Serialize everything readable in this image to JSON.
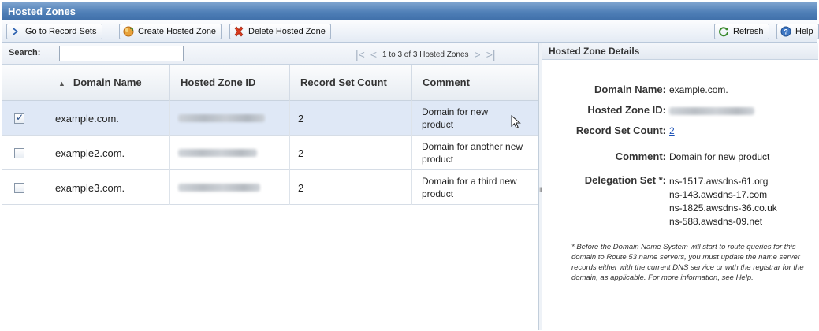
{
  "window": {
    "title": "Hosted Zones"
  },
  "toolbar": {
    "go_to_record_sets": "Go to Record Sets",
    "create_hosted_zone": "Create Hosted Zone",
    "delete_hosted_zone": "Delete Hosted Zone",
    "refresh": "Refresh",
    "help": "Help"
  },
  "search": {
    "label": "Search:",
    "value": ""
  },
  "pager": {
    "text": "1 to 3 of 3 Hosted Zones"
  },
  "table": {
    "columns": [
      "Domain Name",
      "Hosted Zone ID",
      "Record Set Count",
      "Comment"
    ],
    "rows": [
      {
        "selected": true,
        "domain": "example.com.",
        "count": "2",
        "comment": "Domain for new product"
      },
      {
        "selected": false,
        "domain": "example2.com.",
        "count": "2",
        "comment": "Domain for another new product"
      },
      {
        "selected": false,
        "domain": "example3.com.",
        "count": "2",
        "comment": "Domain for a third new product"
      }
    ]
  },
  "details": {
    "title": "Hosted Zone Details",
    "domain_name_label": "Domain Name:",
    "domain_name": "example.com.",
    "zone_id_label": "Hosted Zone ID:",
    "record_set_count_label": "Record Set Count:",
    "record_set_count": "2",
    "comment_label": "Comment:",
    "comment": "Domain for new product",
    "delegation_label": "Delegation Set *:",
    "name_servers": [
      "ns-1517.awsdns-61.org",
      "ns-143.awsdns-17.com",
      "ns-1825.awsdns-36.co.uk",
      "ns-588.awsdns-09.net"
    ],
    "note": "* Before the Domain Name System will start to route queries for this domain to Route 53 name servers, you must update the name server records either with the current DNS service or with the registrar for the domain, as applicable. For more information, see Help."
  },
  "colors": {
    "title_bar": "#4f7fb7",
    "selected_row": "#dfe8f6",
    "link": "#1a4fb5"
  }
}
